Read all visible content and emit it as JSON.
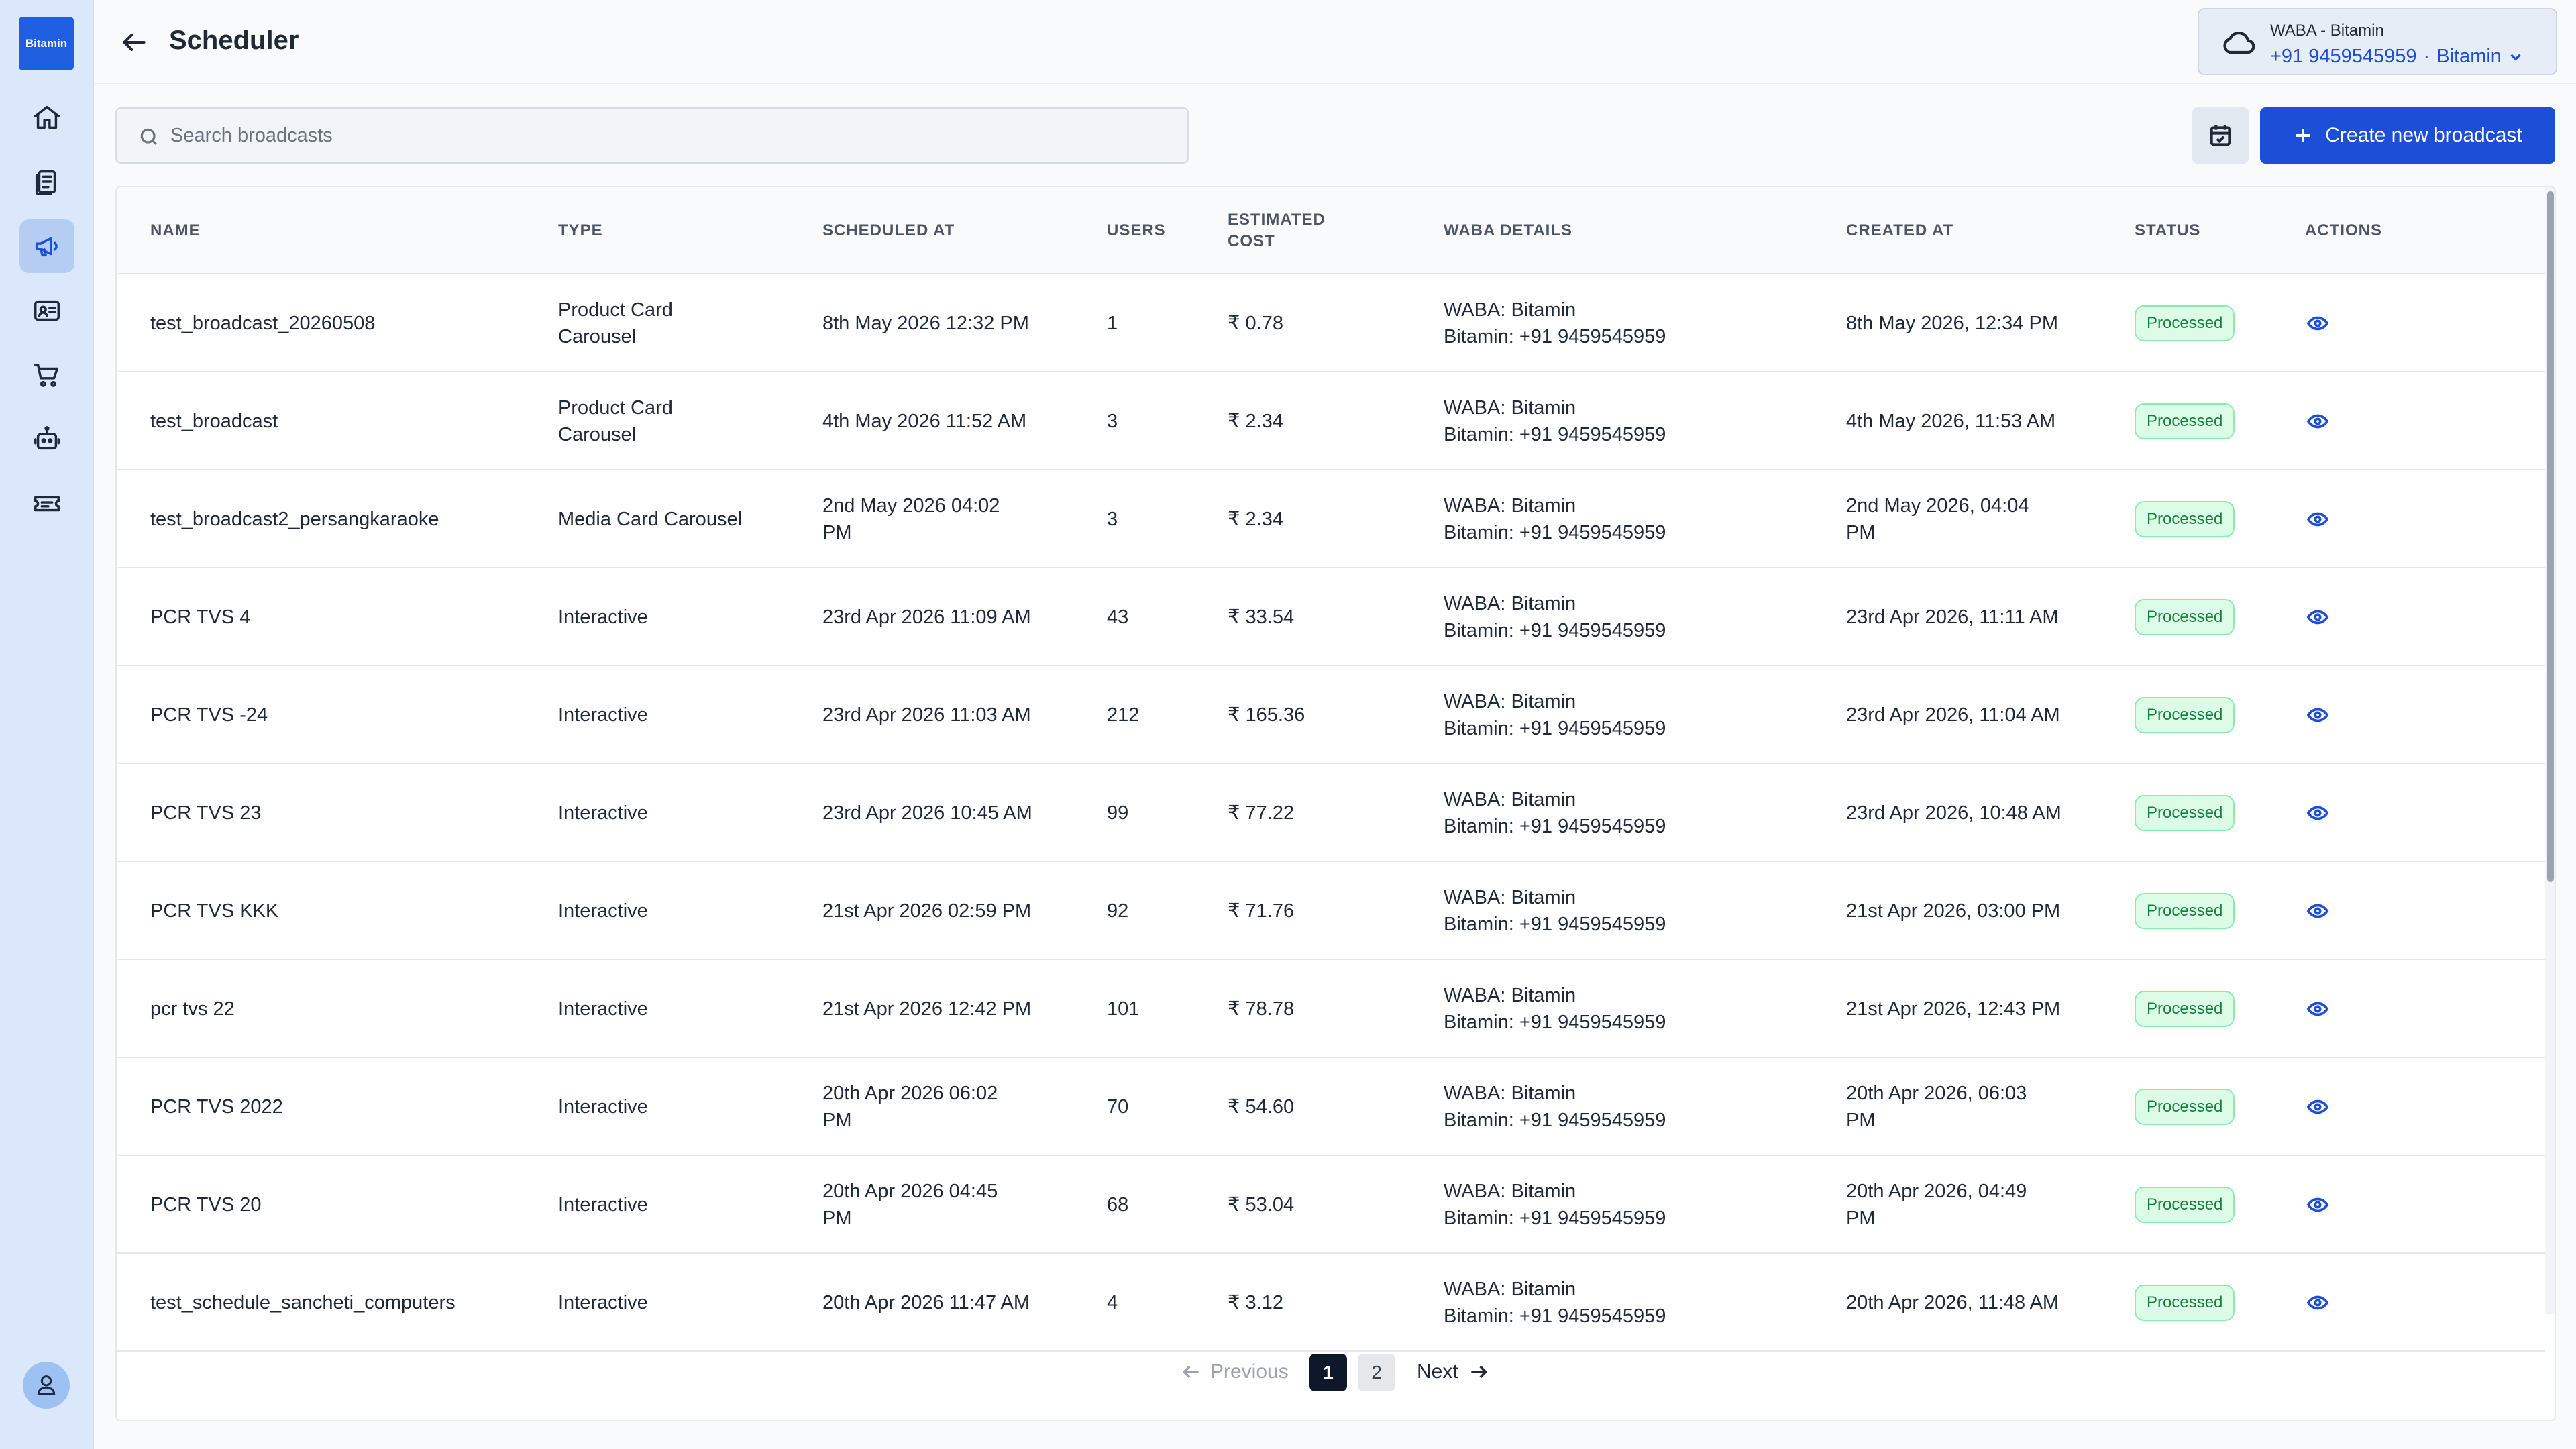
{
  "app": {
    "logo_text": "Bitamin"
  },
  "header": {
    "title": "Scheduler",
    "waba_title": "WABA - Bitamin",
    "waba_phone": "+91 9459545959",
    "waba_name": "Bitamin"
  },
  "toolbar": {
    "search_placeholder": "Search broadcasts",
    "create_label": "Create new broadcast"
  },
  "table": {
    "columns": {
      "name": "NAME",
      "type": "TYPE",
      "scheduled": "SCHEDULED AT",
      "users": "USERS",
      "cost_line1": "ESTIMATED",
      "cost_line2": "COST",
      "waba": "WABA DETAILS",
      "created": "CREATED AT",
      "status": "STATUS",
      "actions": "ACTIONS"
    },
    "rows": [
      {
        "name": "test_broadcast_20260508",
        "type1": "Product Card",
        "type2": "Carousel",
        "sched1": "8th May 2026 12:32 PM",
        "sched2": "",
        "users": "1",
        "cost": "₹ 0.78",
        "waba1": "WABA: Bitamin",
        "waba2": "Bitamin:  +91 9459545959",
        "created1": "8th May 2026, 12:34 PM",
        "created2": "",
        "status": "Processed"
      },
      {
        "name": "test_broadcast",
        "type1": "Product Card",
        "type2": "Carousel",
        "sched1": "4th May 2026 11:52 AM",
        "sched2": "",
        "users": "3",
        "cost": "₹ 2.34",
        "waba1": "WABA: Bitamin",
        "waba2": "Bitamin:  +91 9459545959",
        "created1": "4th May 2026, 11:53 AM",
        "created2": "",
        "status": "Processed"
      },
      {
        "name": "test_broadcast2_persangkaraoke",
        "type1": "Media Card Carousel",
        "type2": "",
        "sched1": "2nd May 2026 04:02",
        "sched2": "PM",
        "users": "3",
        "cost": "₹ 2.34",
        "waba1": "WABA: Bitamin",
        "waba2": "Bitamin:  +91 9459545959",
        "created1": "2nd May 2026, 04:04",
        "created2": "PM",
        "status": "Processed"
      },
      {
        "name": "PCR TVS 4",
        "type1": "Interactive",
        "type2": "",
        "sched1": "23rd Apr 2026 11:09 AM",
        "sched2": "",
        "users": "43",
        "cost": "₹ 33.54",
        "waba1": "WABA: Bitamin",
        "waba2": "Bitamin:  +91 9459545959",
        "created1": "23rd Apr 2026, 11:11 AM",
        "created2": "",
        "status": "Processed"
      },
      {
        "name": "PCR TVS -24",
        "type1": "Interactive",
        "type2": "",
        "sched1": "23rd Apr 2026 11:03 AM",
        "sched2": "",
        "users": "212",
        "cost": "₹ 165.36",
        "waba1": "WABA: Bitamin",
        "waba2": "Bitamin:  +91 9459545959",
        "created1": "23rd Apr 2026, 11:04 AM",
        "created2": "",
        "status": "Processed"
      },
      {
        "name": "PCR TVS 23",
        "type1": "Interactive",
        "type2": "",
        "sched1": "23rd Apr 2026 10:45 AM",
        "sched2": "",
        "users": "99",
        "cost": "₹ 77.22",
        "waba1": "WABA: Bitamin",
        "waba2": "Bitamin:  +91 9459545959",
        "created1": "23rd Apr 2026, 10:48 AM",
        "created2": "",
        "status": "Processed"
      },
      {
        "name": "PCR TVS KKK",
        "type1": "Interactive",
        "type2": "",
        "sched1": "21st Apr 2026 02:59 PM",
        "sched2": "",
        "users": "92",
        "cost": "₹ 71.76",
        "waba1": "WABA: Bitamin",
        "waba2": "Bitamin:  +91 9459545959",
        "created1": "21st Apr 2026, 03:00 PM",
        "created2": "",
        "status": "Processed"
      },
      {
        "name": "pcr tvs 22",
        "type1": "Interactive",
        "type2": "",
        "sched1": "21st Apr 2026 12:42 PM",
        "sched2": "",
        "users": "101",
        "cost": "₹ 78.78",
        "waba1": "WABA: Bitamin",
        "waba2": "Bitamin:  +91 9459545959",
        "created1": "21st Apr 2026, 12:43 PM",
        "created2": "",
        "status": "Processed"
      },
      {
        "name": "PCR TVS 2022",
        "type1": "Interactive",
        "type2": "",
        "sched1": "20th Apr 2026 06:02",
        "sched2": "PM",
        "users": "70",
        "cost": "₹ 54.60",
        "waba1": "WABA: Bitamin",
        "waba2": "Bitamin:  +91 9459545959",
        "created1": "20th Apr 2026, 06:03",
        "created2": "PM",
        "status": "Processed"
      },
      {
        "name": "PCR TVS 20",
        "type1": "Interactive",
        "type2": "",
        "sched1": "20th Apr 2026 04:45",
        "sched2": "PM",
        "users": "68",
        "cost": "₹ 53.04",
        "waba1": "WABA: Bitamin",
        "waba2": "Bitamin:  +91 9459545959",
        "created1": "20th Apr 2026, 04:49",
        "created2": "PM",
        "status": "Processed"
      },
      {
        "name": "test_schedule_sancheti_computers",
        "type1": "Interactive",
        "type2": "",
        "sched1": "20th Apr 2026 11:47 AM",
        "sched2": "",
        "users": "4",
        "cost": "₹ 3.12",
        "waba1": "WABA: Bitamin",
        "waba2": "Bitamin:  +91 9459545959",
        "created1": "20th Apr 2026, 11:48 AM",
        "created2": "",
        "status": "Processed"
      }
    ]
  },
  "pagination": {
    "previous_label": "Previous",
    "next_label": "Next",
    "pages": [
      "1",
      "2"
    ],
    "current_page": "1"
  },
  "colors": {
    "accent": "#1d4ed8",
    "sidebar_bg": "#dbe8fb",
    "status_bg": "#dcfce7",
    "status_text": "#15803d"
  },
  "icons": {
    "sidebar": [
      "home-icon",
      "clipboard-icon",
      "megaphone-icon",
      "contact-card-icon",
      "cart-icon",
      "bot-icon",
      "ticket-icon"
    ],
    "header": [
      "arrow-left-icon",
      "cloud-icon",
      "chevron-down-icon"
    ],
    "toolbar": [
      "search-icon",
      "calendar-check-icon",
      "plus-icon"
    ],
    "row_action": "eye-icon"
  }
}
